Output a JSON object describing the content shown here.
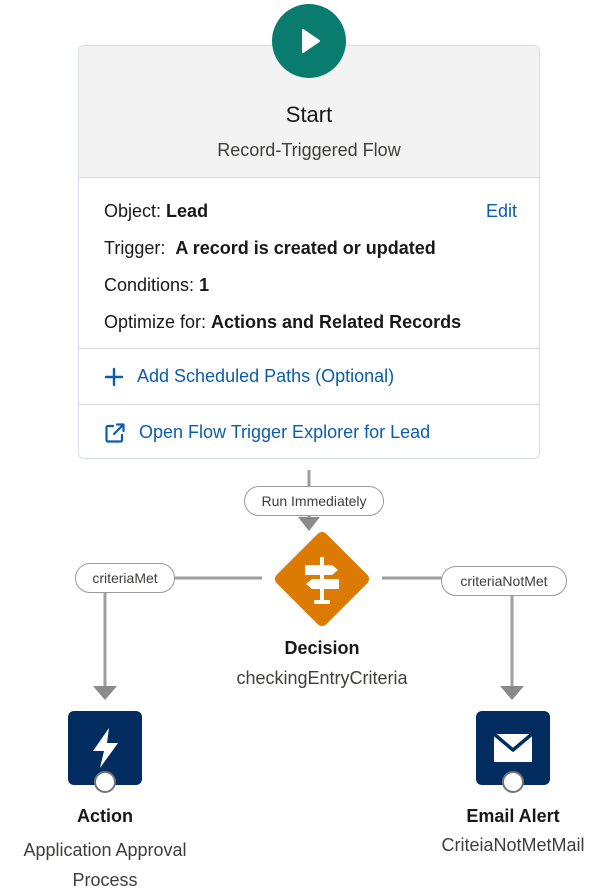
{
  "start": {
    "title": "Start",
    "subtitle": "Record-Triggered Flow",
    "object_label": "Object:",
    "object_value": "Lead",
    "edit_label": "Edit",
    "trigger_label": "Trigger:",
    "trigger_value": "A record is created or updated",
    "conditions_label": "Conditions:",
    "conditions_value": "1",
    "optimize_label": "Optimize for:",
    "optimize_value": "Actions and Related Records",
    "add_paths_label": "Add Scheduled Paths (Optional)",
    "explorer_label": "Open Flow Trigger Explorer for Lead"
  },
  "connectors": {
    "run_immediately": "Run Immediately",
    "criteria_met": "criteriaMet",
    "criteria_not_met": "criteriaNotMet"
  },
  "decision": {
    "type_label": "Decision",
    "name": "checkingEntryCriteria"
  },
  "action": {
    "type_label": "Action",
    "name": "Application Approval Process"
  },
  "email_alert": {
    "type_label": "Email Alert",
    "name": "CriteiaNotMetMail"
  },
  "colors": {
    "start_icon": "#0a7c6f",
    "decision_icon": "#dd7a01",
    "action_tile": "#032d60",
    "link": "#0b5cab",
    "connector": "#9e9e9e"
  },
  "icons": {
    "start": "play-icon",
    "add_paths": "plus-icon",
    "explorer": "new-window-icon",
    "decision": "signpost-icon",
    "action": "lightning-bolt-icon",
    "email_alert": "envelope-icon"
  }
}
